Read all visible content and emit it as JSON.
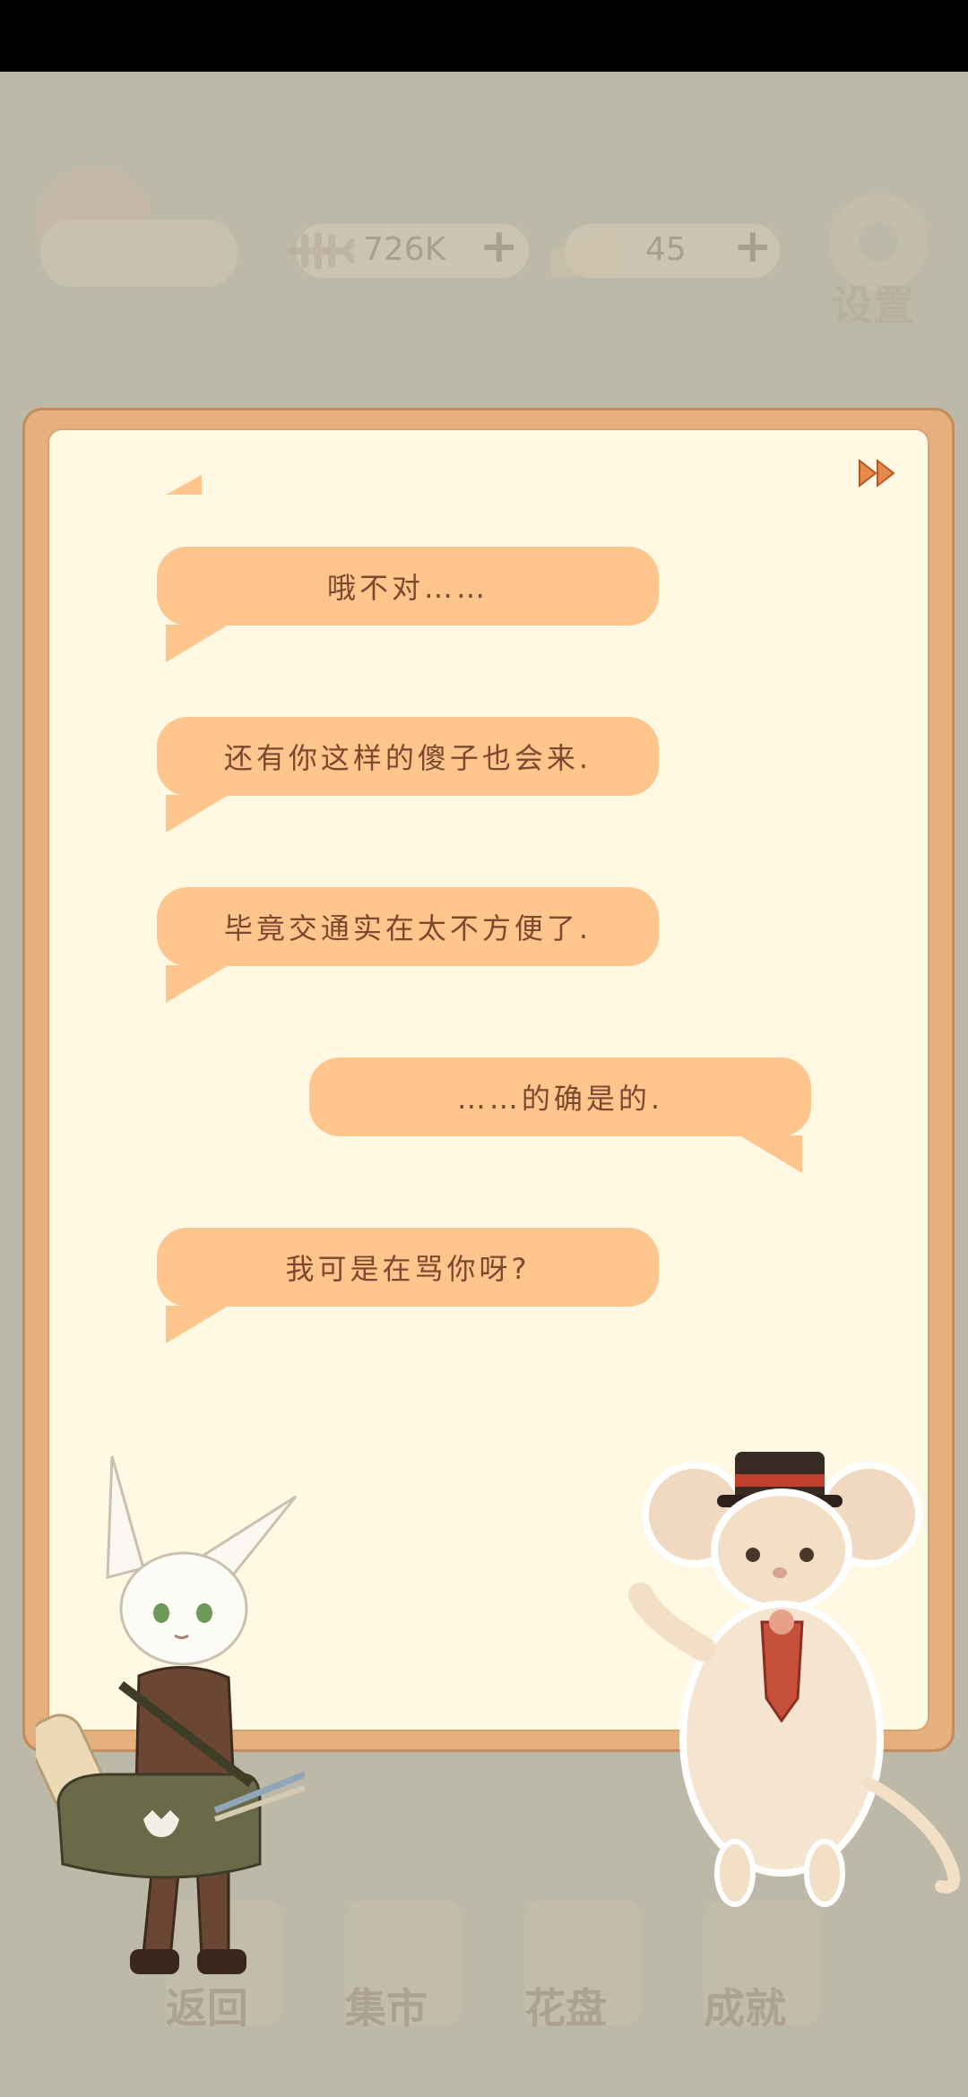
{
  "hud": {
    "fish_value": "726K",
    "cheese_value": "45",
    "settings_label": "设置"
  },
  "dialog": {
    "messages": [
      {
        "side": "left",
        "text": "哦不对……"
      },
      {
        "side": "left",
        "text": "还有你这样的傻子也会来."
      },
      {
        "side": "left",
        "text": "毕竟交通实在太不方便了."
      },
      {
        "side": "right",
        "text": "……的确是的."
      },
      {
        "side": "left",
        "text": "我可是在骂你呀?"
      }
    ],
    "skip_icon": "fast-forward-icon"
  },
  "bottom_nav": {
    "items": [
      {
        "label": "返回",
        "icon": "back-icon"
      },
      {
        "label": "集市",
        "icon": "market-icon"
      },
      {
        "label": "花盘",
        "icon": "flowerpot-icon"
      },
      {
        "label": "成就",
        "icon": "trophy-icon"
      }
    ]
  },
  "colors": {
    "bubble": "#fec58d",
    "panel_border": "#e5b07e",
    "panel_fill": "#fff8e2",
    "text": "#7b4a2e"
  }
}
